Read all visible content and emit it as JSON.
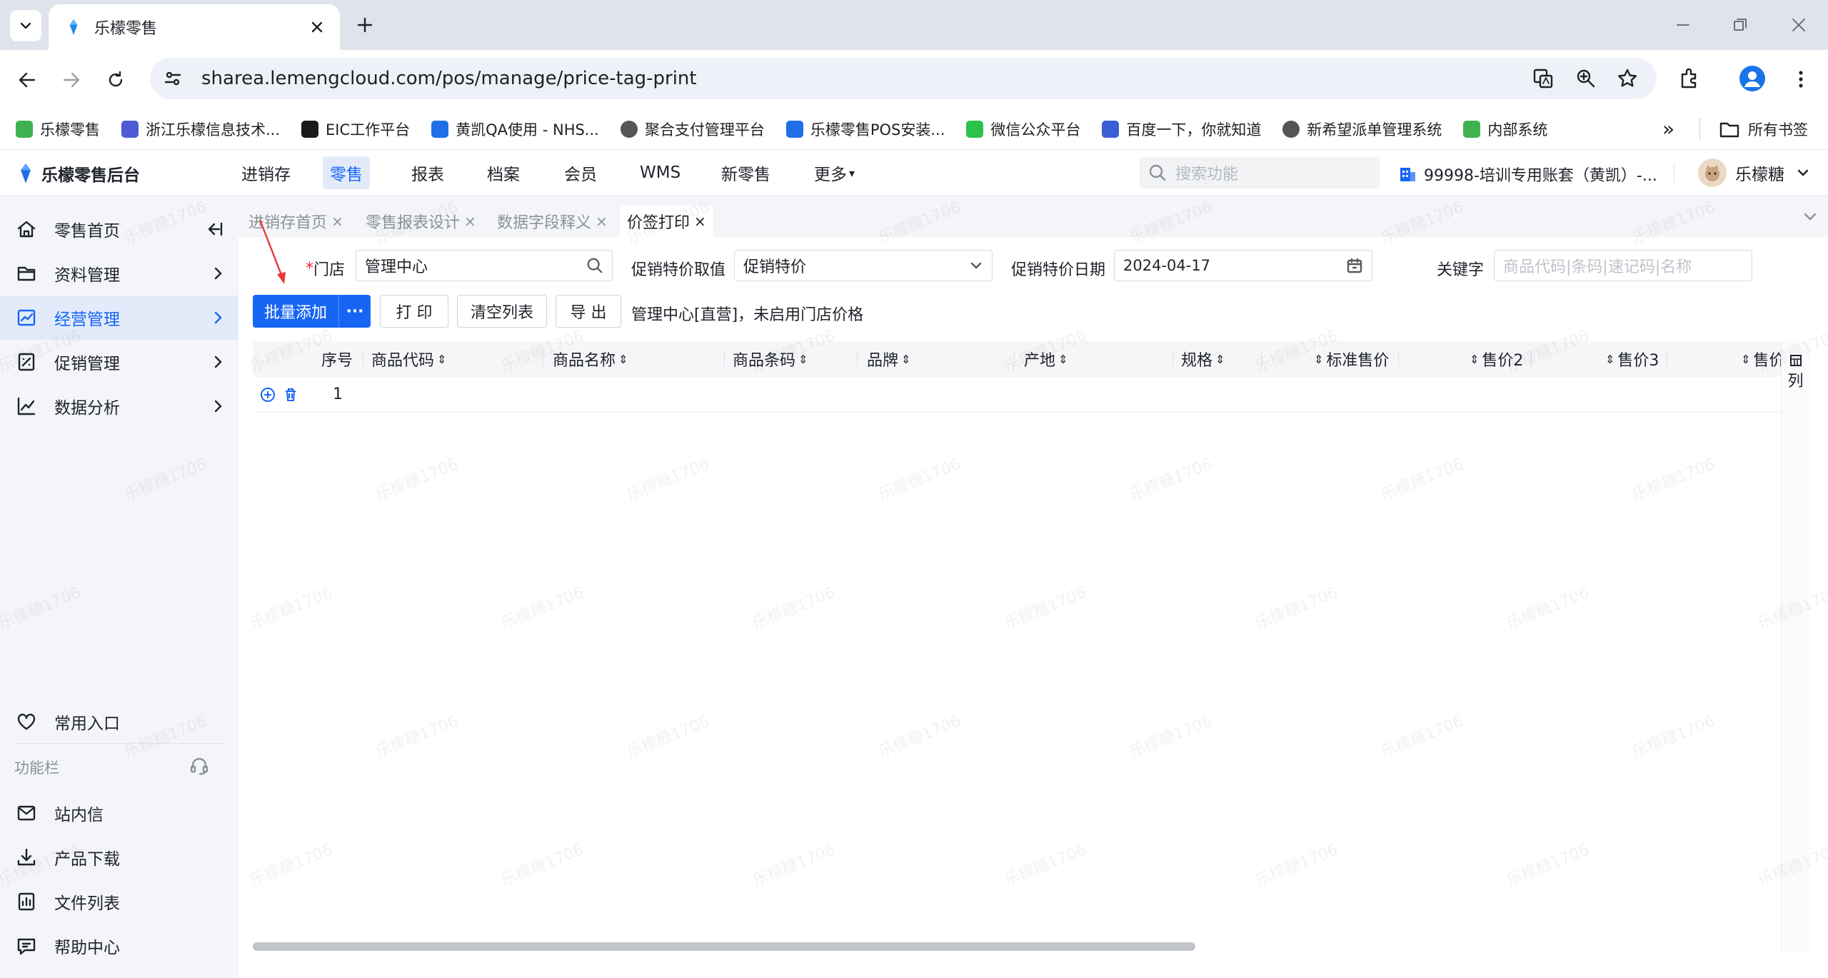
{
  "browser": {
    "tab_title": "乐檬零售",
    "url": "sharea.lemengcloud.com/pos/manage/price-tag-print",
    "bookmarks": [
      "乐檬零售",
      "浙江乐檬信息技术...",
      "EIC工作平台",
      "黄凯QA使用 - NHS...",
      "聚合支付管理平台",
      "乐檬零售POS安装...",
      "微信公众平台",
      "百度一下，你就知道",
      "新希望派单管理系统",
      "内部系统"
    ],
    "all_bookmarks": "所有书签"
  },
  "app": {
    "logo": "乐檬零售后台",
    "nav": [
      "进销存",
      "零售",
      "报表",
      "档案",
      "会员",
      "WMS",
      "新零售",
      "更多"
    ],
    "search_placeholder": "搜索功能",
    "account": "99998-培训专用账套（黄凯）-...",
    "user": "乐檬糖"
  },
  "sidebar": {
    "items": [
      "零售首页",
      "资料管理",
      "经营管理",
      "促销管理",
      "数据分析"
    ],
    "common": "常用入口",
    "func_bar": "功能栏",
    "bottom": [
      "站内信",
      "产品下载",
      "文件列表",
      "帮助中心"
    ]
  },
  "page_tabs": [
    "进销存首页",
    "零售报表设计",
    "数据字段释义",
    "价签打印"
  ],
  "form": {
    "store_label": "门店",
    "store_value": "管理中心",
    "promo_label": "促销特价取值",
    "promo_value": "促销特价",
    "date_label": "促销特价日期",
    "date_value": "2024-04-17",
    "keyword_label": "关键字",
    "keyword_placeholder": "商品代码|条码|速记码|名称"
  },
  "actions": {
    "batch_add": "批量添加",
    "more": "···",
    "print": "打 印",
    "clear": "清空列表",
    "export": "导 出",
    "info": "管理中心[直营]，未启用门店价格"
  },
  "table": {
    "columns": [
      "序号",
      "商品代码",
      "商品名称",
      "商品条码",
      "品牌",
      "产地",
      "规格",
      "标准售价",
      "售价2",
      "售价3",
      "售价"
    ],
    "rows": [
      {
        "index": "1"
      }
    ],
    "col_setting": "列"
  },
  "watermark": "乐檬糖1706",
  "colors": {
    "primary": "#1765f5",
    "annotation": "#e53935"
  }
}
